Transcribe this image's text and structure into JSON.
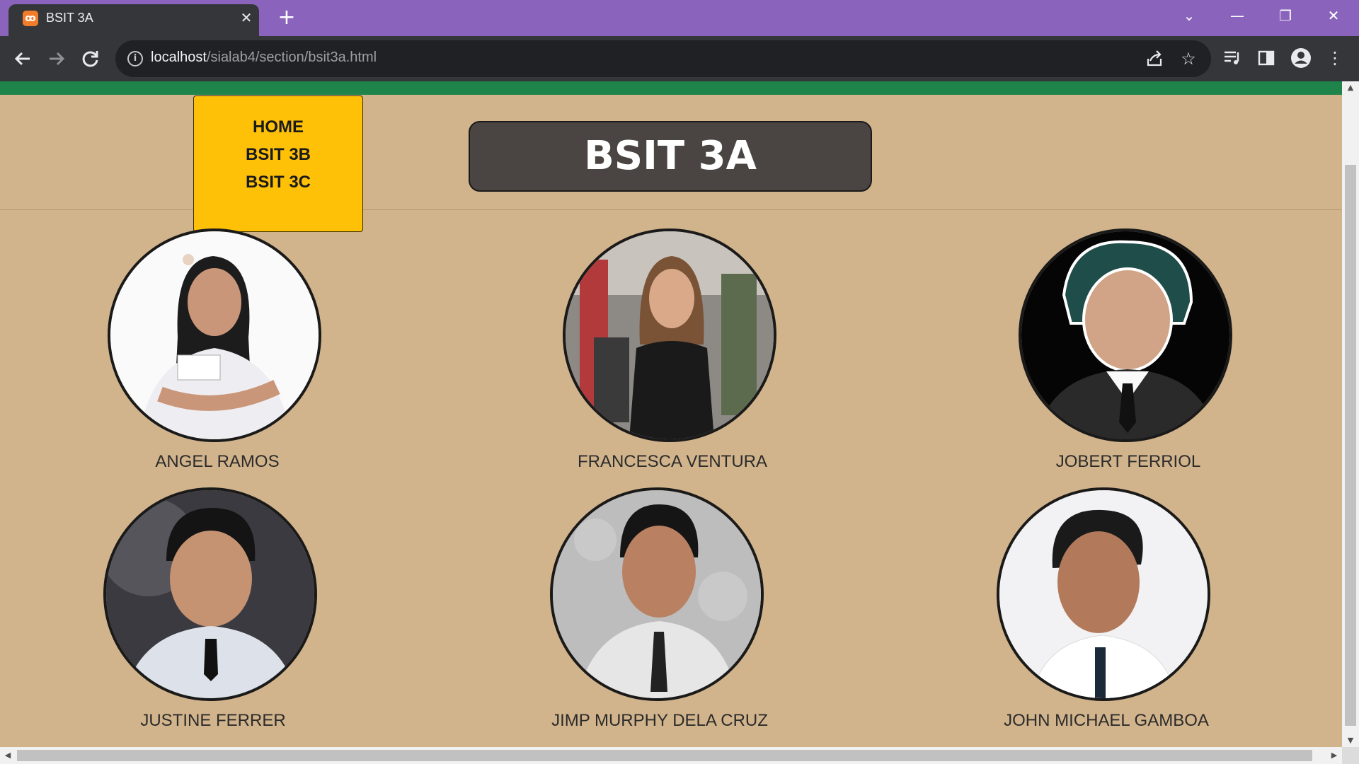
{
  "browser": {
    "tab_title": "BSIT 3A",
    "favicon": "xampp-icon",
    "url_host": "localhost",
    "url_path": "/sialab4/section/bsit3a.html",
    "tabstrip_color": "#8a64bc"
  },
  "page": {
    "accent_bar_color": "#1e8449",
    "background_color": "#d2b48c",
    "title": "BSIT 3A",
    "menu": {
      "color": "#ffc107",
      "items": [
        {
          "label": "HOME"
        },
        {
          "label": "BSIT 3B"
        },
        {
          "label": "BSIT 3C"
        }
      ]
    },
    "students": [
      {
        "name": "ANGEL RAMOS"
      },
      {
        "name": "FRANCESCA VENTURA"
      },
      {
        "name": "JOBERT FERRIOL"
      },
      {
        "name": "JUSTINE FERRER"
      },
      {
        "name": "JIMP MURPHY DELA CRUZ"
      },
      {
        "name": "JOHN MICHAEL GAMBOA"
      }
    ]
  }
}
